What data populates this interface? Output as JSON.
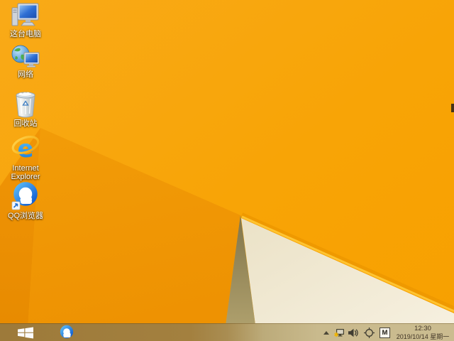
{
  "desktop": {
    "icons": [
      {
        "name": "this-pc",
        "label": "这台电脑"
      },
      {
        "name": "network",
        "label": "网络"
      },
      {
        "name": "recycle-bin",
        "label": "回收站"
      },
      {
        "name": "internet-explorer",
        "label": "Internet Explorer"
      },
      {
        "name": "qq-browser",
        "label": "QQ浏览器"
      }
    ]
  },
  "taskbar": {
    "start_button_icon": "windows-logo",
    "pinned_icons": [
      "qq-browser-logo"
    ],
    "tray": {
      "icons": [
        "hidden-icons-chevron",
        "network-status",
        "volume",
        "crosshair"
      ],
      "ime_indicator": "M",
      "time": "12:30",
      "date": "2019/10/14 星期一"
    }
  },
  "wallpaper": {
    "colors": {
      "main_orange": "#f8a406",
      "deep_orange": "#ee9403",
      "dark_orange": "#e78a00",
      "cream": "#f3ecd9",
      "olive": "#9c8d58",
      "ridge_highlight": "#ffc431"
    }
  }
}
